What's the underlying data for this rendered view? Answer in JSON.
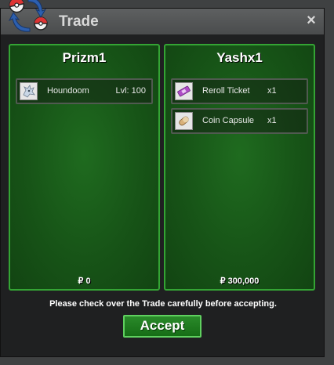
{
  "window": {
    "title": "Trade",
    "close_glyph": "×"
  },
  "left_panel": {
    "player": "Prizm1",
    "items": [
      {
        "name": "Houndoom",
        "level": "Lvl: 100",
        "icon": "houndoom-sprite-icon"
      }
    ],
    "money": "₽ 0"
  },
  "right_panel": {
    "player": "Yashx1",
    "items": [
      {
        "name": "Reroll Ticket",
        "qty": "x1",
        "icon": "reroll-ticket-icon"
      },
      {
        "name": "Coin Capsule",
        "qty": "x1",
        "icon": "coin-capsule-icon"
      }
    ],
    "money": "₽ 300,000"
  },
  "notice": "Please check over the Trade carefully before accepting.",
  "accept_label": "Accept",
  "colors": {
    "panel_green": "#175417",
    "panel_border": "#34a434",
    "accept_border": "#5fd05f"
  }
}
